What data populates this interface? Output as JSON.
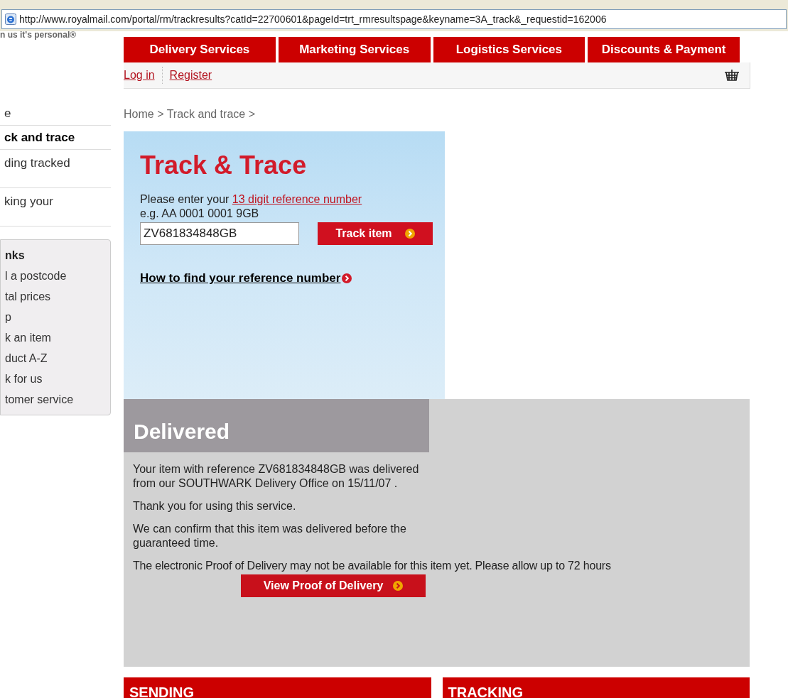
{
  "address_bar": {
    "url": "http://www.royalmail.com/portal/rm/trackresults?catId=22700601&pageId=trt_rmresultspage&keyname=3A_track&_requestid=162006"
  },
  "tagline": "n us it's personal®",
  "nav_tabs": [
    {
      "label": "Delivery Services"
    },
    {
      "label": "Marketing Services"
    },
    {
      "label": "Logistics Services"
    },
    {
      "label": "Discounts & Payment"
    }
  ],
  "account_links": [
    "Log in",
    "Register"
  ],
  "sidebar": {
    "items": [
      {
        "label": "e",
        "selected": false,
        "tall": false
      },
      {
        "label": "ck and trace",
        "selected": true,
        "tall": false
      },
      {
        "label": "ding tracked",
        "selected": false,
        "tall": true
      },
      {
        "label": "king your",
        "selected": false,
        "tall": true
      }
    ],
    "links_box": {
      "heading": "nks",
      "items": [
        "l a postcode",
        "tal prices",
        "p",
        "k an item",
        "duct A-Z",
        "k for us",
        "tomer service"
      ]
    }
  },
  "breadcrumb": "Home > Track and trace >",
  "track_panel": {
    "title": "Track & Trace",
    "prompt": "Please enter your ",
    "prompt_link": "13 digit reference number",
    "example": "e.g. AA 0001 0001 9GB",
    "reference_field": {
      "value": "ZV681834848GB"
    },
    "track_button": "Track item",
    "help_link": "How to find your reference number"
  },
  "result": {
    "status": "Delivered",
    "paragraphs": [
      "Your item with reference ZV681834848GB was delivered from our SOUTHWARK Delivery Office on 15/11/07 .",
      "Thank you for using this service.",
      "We can confirm that this item was delivered before the guaranteed time."
    ],
    "proof_note": "The electronic Proof of Delivery may not be available for this item yet. Please allow up to 72 hours",
    "proof_button": "View Proof of Delivery"
  },
  "bottom_sections": [
    "SENDING",
    "TRACKING"
  ]
}
